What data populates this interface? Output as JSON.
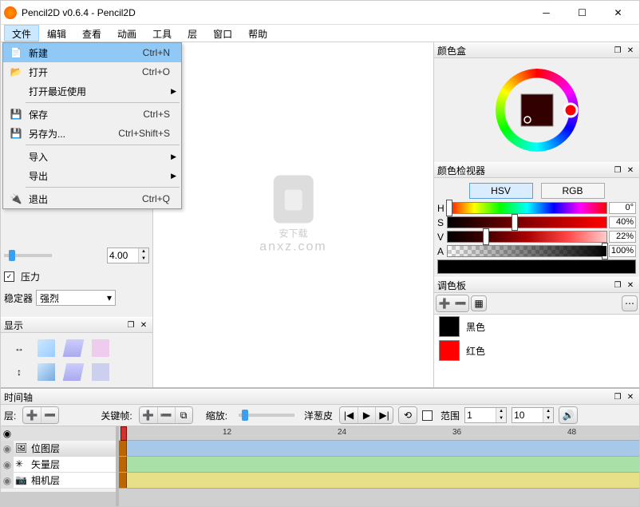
{
  "title": "Pencil2D v0.6.4 - Pencil2D",
  "menus": [
    "文件",
    "编辑",
    "查看",
    "动画",
    "工具",
    "层",
    "窗口",
    "帮助"
  ],
  "file_menu": {
    "new": {
      "l": "新建",
      "sc": "Ctrl+N"
    },
    "open": {
      "l": "打开",
      "sc": "Ctrl+O"
    },
    "recent": {
      "l": "打开最近使用"
    },
    "save": {
      "l": "保存",
      "sc": "Ctrl+S"
    },
    "saveas": {
      "l": "另存为...",
      "sc": "Ctrl+Shift+S"
    },
    "import": {
      "l": "导入"
    },
    "export": {
      "l": "导出"
    },
    "exit": {
      "l": "退出",
      "sc": "Ctrl+Q"
    }
  },
  "opts": {
    "spin": "4.00",
    "pressure": "压力",
    "stabilizer_lbl": "稳定器",
    "stabilizer_val": "强烈"
  },
  "display_hdr": "显示",
  "right": {
    "colorbox": "颜色盒",
    "inspector": "颜色检视器",
    "hsv": "HSV",
    "rgb": "RGB",
    "h_v": "0°",
    "s_v": "40%",
    "v_v": "22%",
    "a_v": "100%",
    "palette": "调色板",
    "pal_items": [
      {
        "name": "黑色",
        "c": "#000000"
      },
      {
        "name": "红色",
        "c": "#ff0000"
      }
    ]
  },
  "timeline": {
    "hdr": "时间轴",
    "layer_lbl": "层:",
    "keyframe": "关键帧:",
    "zoom": "缩放:",
    "onion": "洋葱皮",
    "range": "范围",
    "r1": "1",
    "r2": "10",
    "layers": [
      {
        "n": "位图层",
        "t": "bitmap"
      },
      {
        "n": "矢量层",
        "t": "vector"
      },
      {
        "n": "相机层",
        "t": "camera"
      }
    ],
    "ticks": [
      "12",
      "24",
      "36",
      "48"
    ]
  },
  "wm": {
    "a": "安下载",
    "b": "anxz.com"
  }
}
